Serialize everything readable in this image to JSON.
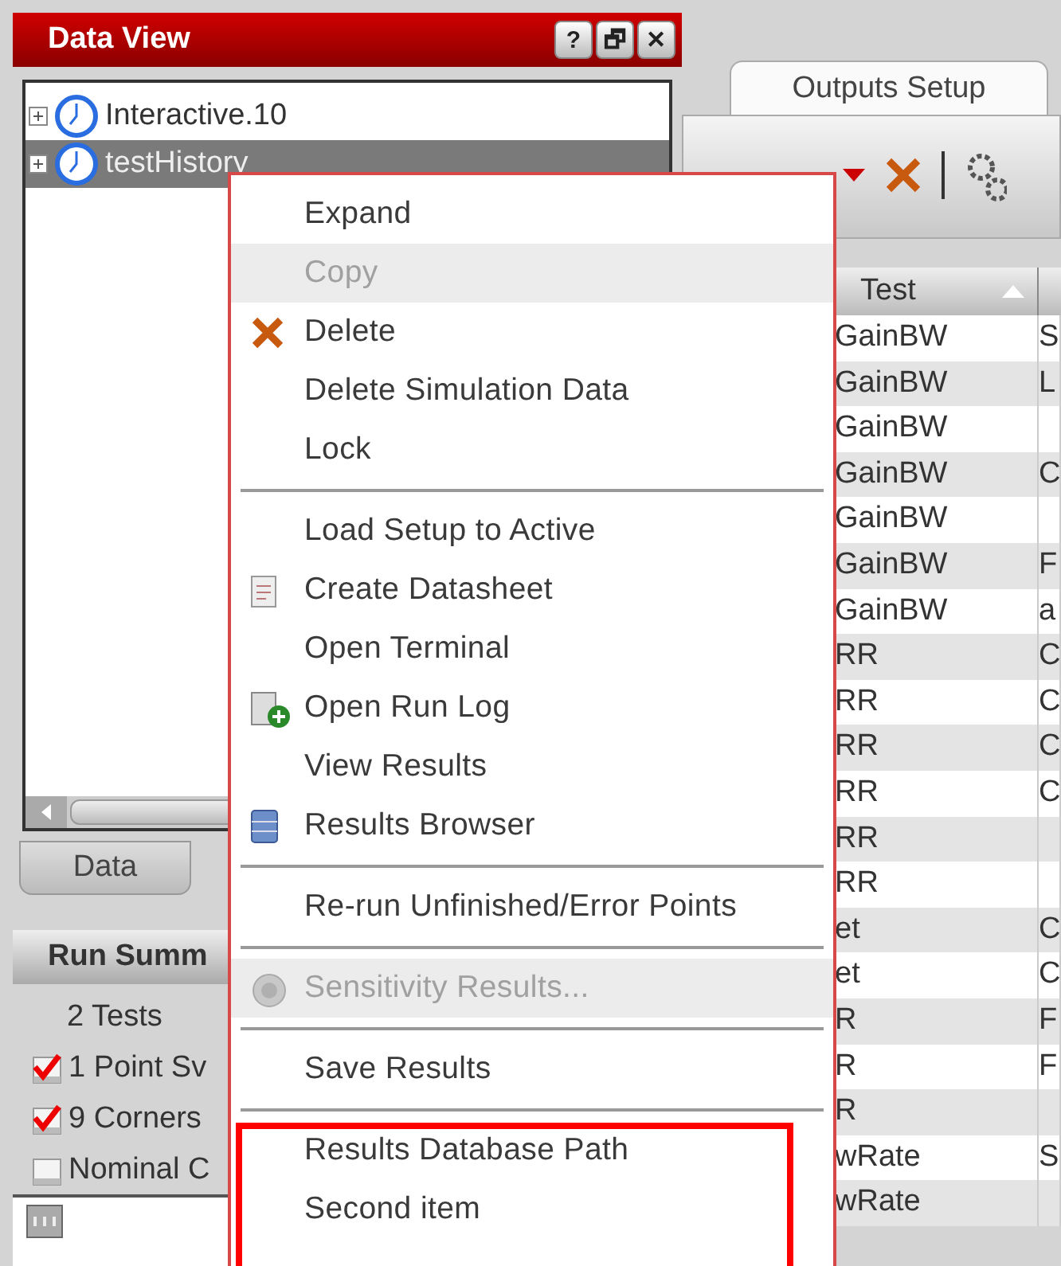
{
  "data_view": {
    "title": "Data View",
    "window_buttons": [
      "?",
      "🗗",
      "✕"
    ],
    "tree": [
      {
        "label": "Interactive.10",
        "selected": false
      },
      {
        "label": "testHistory",
        "selected": true
      }
    ],
    "tabs": [
      {
        "label": "Data",
        "selected": false
      }
    ],
    "run_summary": {
      "title": "Run Summ",
      "items": [
        {
          "kind": "text",
          "label": "2 Tests"
        },
        {
          "kind": "check",
          "label": "1 Point Sv",
          "checked": true
        },
        {
          "kind": "check",
          "label": "9 Corners",
          "checked": true
        },
        {
          "kind": "check",
          "label": "Nominal C",
          "checked": false
        }
      ]
    }
  },
  "outputs": {
    "tab": {
      "label": "Outputs Setup",
      "selected": true
    },
    "table": {
      "columns": [
        {
          "label": "Test",
          "sorted": true
        }
      ],
      "rows": [
        [
          "GainBW",
          "S"
        ],
        [
          "GainBW",
          "L"
        ],
        [
          "GainBW",
          ""
        ],
        [
          "GainBW",
          "C"
        ],
        [
          "GainBW",
          ""
        ],
        [
          "GainBW",
          "F"
        ],
        [
          "GainBW",
          "a"
        ],
        [
          "RR",
          "C"
        ],
        [
          "RR",
          "C"
        ],
        [
          "RR",
          "C"
        ],
        [
          "RR",
          "C"
        ],
        [
          "RR",
          ""
        ],
        [
          "RR",
          ""
        ],
        [
          "et",
          "C"
        ],
        [
          "et",
          "C"
        ],
        [
          "R",
          "F"
        ],
        [
          "R",
          "F"
        ],
        [
          "R",
          ""
        ],
        [
          "wRate",
          "S"
        ],
        [
          "wRate",
          ""
        ]
      ]
    }
  },
  "context_menu": [
    {
      "kind": "plain",
      "label": "Expand",
      "disabled": false
    },
    {
      "kind": "plain",
      "label": "Copy",
      "disabled": true
    },
    {
      "kind": "delete",
      "label": "Delete",
      "disabled": false
    },
    {
      "kind": "plain",
      "label": "Delete Simulation Data",
      "disabled": false
    },
    {
      "kind": "plain",
      "label": "Lock",
      "disabled": false
    },
    {
      "kind": "separator"
    },
    {
      "kind": "plain",
      "label": "Load Setup to Active",
      "disabled": false
    },
    {
      "kind": "datasheet",
      "label": "Create Datasheet",
      "disabled": false
    },
    {
      "kind": "plain",
      "label": "Open Terminal",
      "disabled": false
    },
    {
      "kind": "log",
      "label": "Open Run Log",
      "disabled": false
    },
    {
      "kind": "plain",
      "label": "View Results",
      "disabled": false
    },
    {
      "kind": "browser",
      "label": "Results Browser",
      "disabled": false
    },
    {
      "kind": "separator"
    },
    {
      "kind": "plain",
      "label": "Re-run Unfinished/Error Points",
      "disabled": false
    },
    {
      "kind": "separator"
    },
    {
      "kind": "sensitivity",
      "label": "Sensitivity Results...",
      "disabled": true
    },
    {
      "kind": "separator"
    },
    {
      "kind": "plain",
      "label": "Save Results",
      "disabled": false
    },
    {
      "kind": "separator"
    },
    {
      "kind": "plain",
      "label": "Results Database Path",
      "disabled": false,
      "framed": true
    },
    {
      "kind": "plain",
      "label": "Second item",
      "disabled": false,
      "framed": true
    }
  ]
}
